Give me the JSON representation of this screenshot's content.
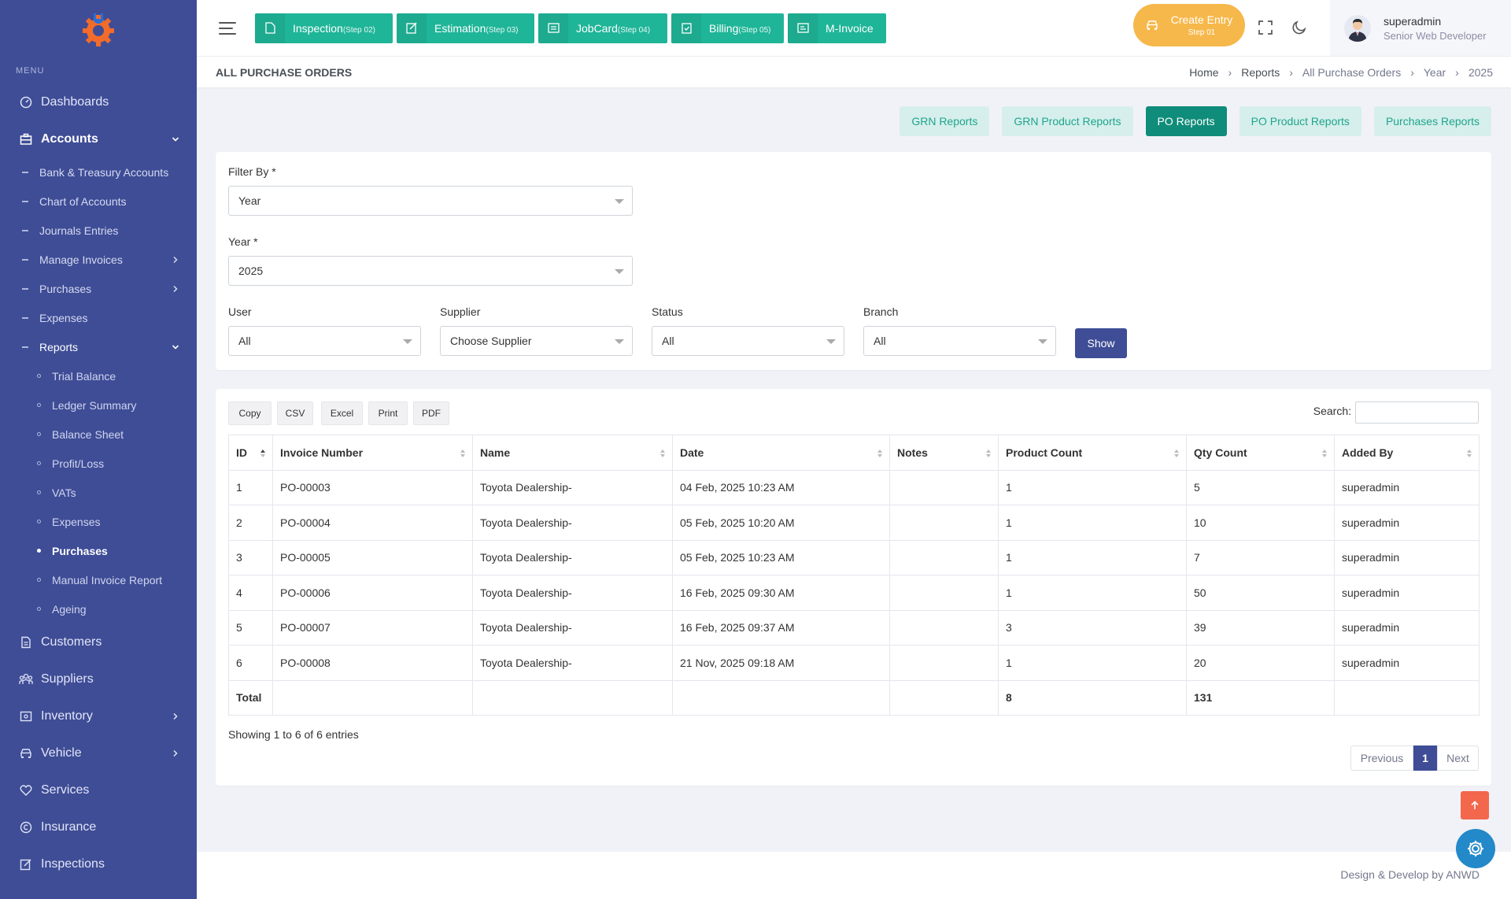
{
  "sidebar": {
    "menu_title": "MENU",
    "items": [
      {
        "label": "Dashboards"
      },
      {
        "label": "Accounts"
      },
      {
        "label": "Customers"
      },
      {
        "label": "Suppliers"
      },
      {
        "label": "Inventory"
      },
      {
        "label": "Vehicle"
      },
      {
        "label": "Services"
      },
      {
        "label": "Insurance"
      },
      {
        "label": "Inspections"
      }
    ],
    "accounts_sub": [
      {
        "label": "Bank & Treasury Accounts"
      },
      {
        "label": "Chart of Accounts"
      },
      {
        "label": "Journals Entries"
      },
      {
        "label": "Manage Invoices"
      },
      {
        "label": "Purchases"
      },
      {
        "label": "Expenses"
      },
      {
        "label": "Reports"
      }
    ],
    "reports_sub": [
      {
        "label": "Trial Balance"
      },
      {
        "label": "Ledger Summary"
      },
      {
        "label": "Balance Sheet"
      },
      {
        "label": "Profit/Loss"
      },
      {
        "label": "VATs"
      },
      {
        "label": "Expenses"
      },
      {
        "label": "Purchases"
      },
      {
        "label": "Manual Invoice Report"
      },
      {
        "label": "Ageing"
      }
    ]
  },
  "topbar": {
    "steps": [
      {
        "label": "Inspection",
        "step": "(Step 02)"
      },
      {
        "label": "Estimation",
        "step": "(Step 03)"
      },
      {
        "label": "JobCard",
        "step": "(Step 04)"
      },
      {
        "label": "Billing",
        "step": "(Step 05)"
      },
      {
        "label": "M-Invoice",
        "step": ""
      }
    ],
    "create_entry": {
      "label": "Create Entry",
      "step": "Step 01"
    },
    "user": {
      "name": "superadmin",
      "role": "Senior Web Developer"
    }
  },
  "page": {
    "title": "ALL PURCHASE ORDERS",
    "breadcrumb": [
      "Home",
      "Reports",
      "All Purchase Orders",
      "Year",
      "2025"
    ]
  },
  "report_tabs": [
    {
      "label": "GRN Reports"
    },
    {
      "label": "GRN Product Reports"
    },
    {
      "label": "PO Reports"
    },
    {
      "label": "PO Product Reports"
    },
    {
      "label": "Purchases Reports"
    }
  ],
  "filters": {
    "filter_by": {
      "label": "Filter By *",
      "value": "Year"
    },
    "year": {
      "label": "Year *",
      "value": "2025"
    },
    "user": {
      "label": "User",
      "value": "All"
    },
    "supplier": {
      "label": "Supplier",
      "value": "Choose Supplier"
    },
    "status": {
      "label": "Status",
      "value": "All"
    },
    "branch": {
      "label": "Branch",
      "value": "All"
    },
    "show_label": "Show"
  },
  "table": {
    "export_buttons": [
      "Copy",
      "CSV",
      "Excel",
      "Print",
      "PDF"
    ],
    "search_label": "Search:",
    "columns": [
      "ID",
      "Invoice Number",
      "Name",
      "Date",
      "Notes",
      "Product Count",
      "Qty Count",
      "Added By"
    ],
    "rows": [
      [
        "1",
        "PO-00003",
        "Toyota Dealership-",
        "04 Feb, 2025 10:23 AM",
        "",
        "1",
        "5",
        "superadmin"
      ],
      [
        "2",
        "PO-00004",
        "Toyota Dealership-",
        "05 Feb, 2025 10:20 AM",
        "",
        "1",
        "10",
        "superadmin"
      ],
      [
        "3",
        "PO-00005",
        "Toyota Dealership-",
        "05 Feb, 2025 10:23 AM",
        "",
        "1",
        "7",
        "superadmin"
      ],
      [
        "4",
        "PO-00006",
        "Toyota Dealership-",
        "16 Feb, 2025 09:30 AM",
        "",
        "1",
        "50",
        "superadmin"
      ],
      [
        "5",
        "PO-00007",
        "Toyota Dealership-",
        "16 Feb, 2025 09:37 AM",
        "",
        "3",
        "39",
        "superadmin"
      ],
      [
        "6",
        "PO-00008",
        "Toyota Dealership-",
        "21 Nov, 2025 09:18 AM",
        "",
        "1",
        "20",
        "superadmin"
      ]
    ],
    "total": {
      "label": "Total",
      "product_count": "8",
      "qty_count": "131"
    },
    "info": "Showing 1 to 6 of 6 entries",
    "pagination": {
      "previous": "Previous",
      "current": "1",
      "next": "Next"
    }
  },
  "footer": {
    "text": "Design & Develop by ANWD"
  },
  "colors": {
    "sidebar": "#3f4d96",
    "accent": "#1fb598",
    "create": "#f6b84b",
    "scroll_top": "#f3684d"
  }
}
